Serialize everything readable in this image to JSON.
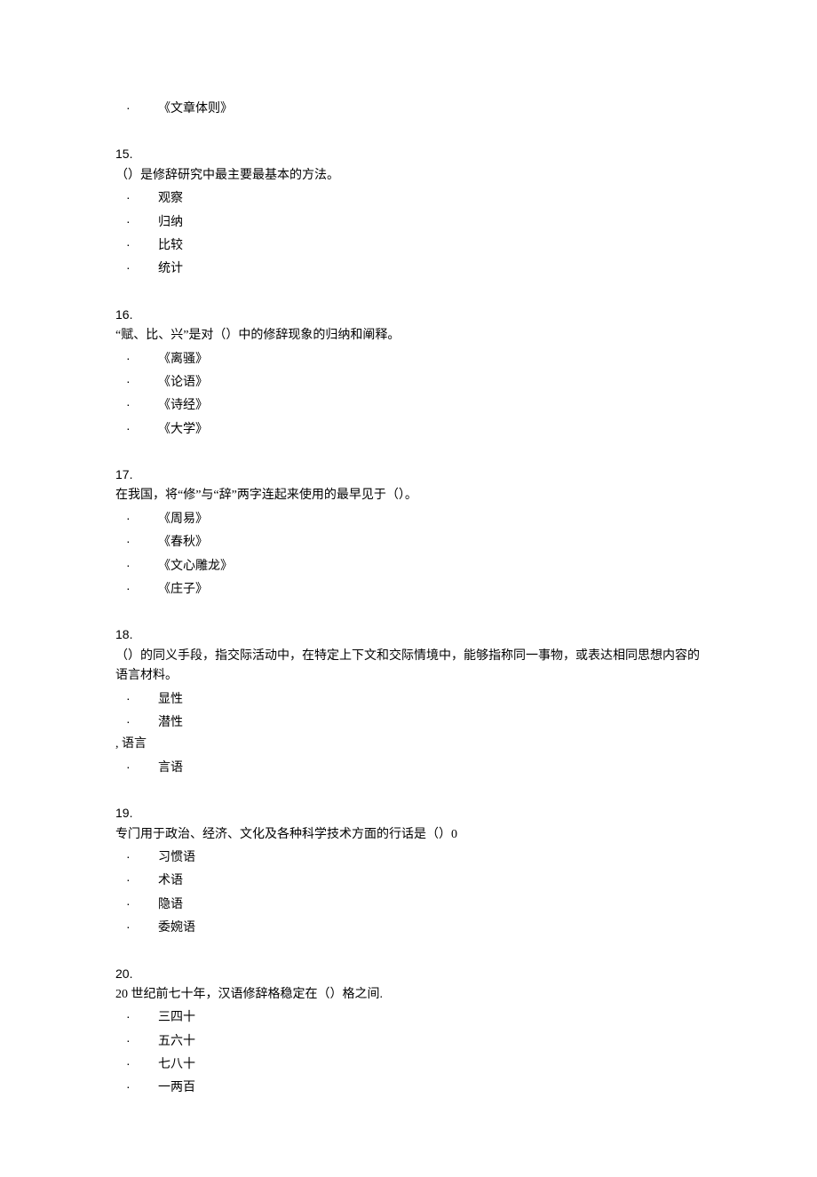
{
  "orphan_option": "《文章体则》",
  "questions": [
    {
      "number": "15.",
      "text": "（）是修辞研究中最主要最基本的方法。",
      "options": [
        "观察",
        "归纳",
        "比较",
        "统计"
      ]
    },
    {
      "number": "16.",
      "text": "“赋、比、兴”是对（）中的修辞现象的归纳和阐释。",
      "options": [
        "《离骚》",
        "《论语》",
        "《诗经》",
        "《大学》"
      ]
    },
    {
      "number": "17.",
      "text": "在我国，将“修”与“辞”两字连起来使用的最早见于（）。",
      "options": [
        "《周易》",
        "《春秋》",
        "《文心雕龙》",
        "《庄子》"
      ]
    },
    {
      "number": "18.",
      "text": "（）的同义手段，指交际活动中，在特定上下文和交际情境中，能够指称同一事物，或表达相同思想内容的语言材料。",
      "options_part1": [
        "显性",
        "潜性"
      ],
      "inline_note": ", 语言",
      "options_part2": [
        "言语"
      ]
    },
    {
      "number": "19.",
      "text": "专门用于政治、经济、文化及各种科学技术方面的行话是（）0",
      "options": [
        "习惯语",
        "术语",
        "隐语",
        "委婉语"
      ]
    },
    {
      "number": "20.",
      "text": "20 世纪前七十年，汉语修辞格稳定在（）格之间.",
      "options": [
        "三四十",
        "五六十",
        "七八十",
        "一两百"
      ]
    }
  ],
  "bullet_char": "·"
}
